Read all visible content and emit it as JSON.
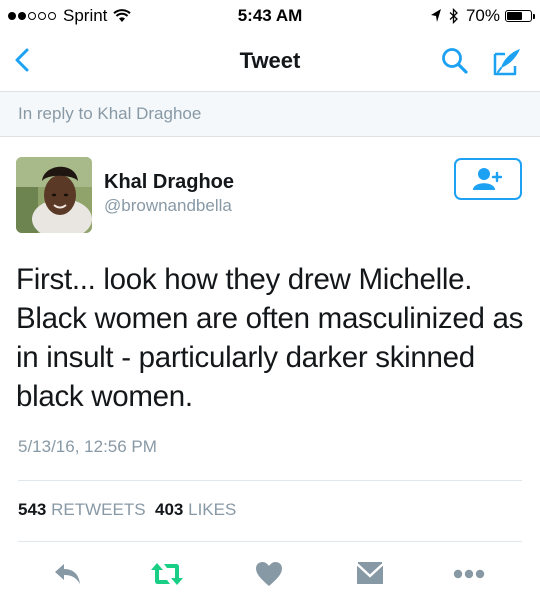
{
  "status_bar": {
    "carrier": "Sprint",
    "time": "5:43 AM",
    "battery_percent": "70%",
    "battery_level": 0.7,
    "signal_full": 2,
    "signal_total": 5,
    "icons": [
      "wifi-icon",
      "location-arrow-icon",
      "bluetooth-icon",
      "battery-icon"
    ]
  },
  "nav": {
    "title": "Tweet",
    "icons": [
      "back-chevron-icon",
      "search-icon",
      "compose-tweet-icon"
    ]
  },
  "reply_banner": {
    "text": "In reply to Khal Draghoe"
  },
  "author": {
    "display_name": "Khal Draghoe",
    "handle": "@brownandbella",
    "follow_icon": "add-user-icon"
  },
  "tweet": {
    "text": "First... look how they drew Michelle. Black women are often masculinized as in insult - particularly darker skinned black women.",
    "timestamp": "5/13/16, 12:56 PM"
  },
  "stats": {
    "retweets_count": "543",
    "retweets_label": "RETWEETS",
    "likes_count": "403",
    "likes_label": "LIKES"
  },
  "actions": [
    "reply-icon",
    "retweet-icon",
    "like-heart-icon",
    "direct-message-icon",
    "more-dots-icon"
  ],
  "colors": {
    "accent": "#1da1f2",
    "retweet_green": "#19cf86",
    "gray_icon": "#8899a6",
    "text": "#14171a"
  }
}
